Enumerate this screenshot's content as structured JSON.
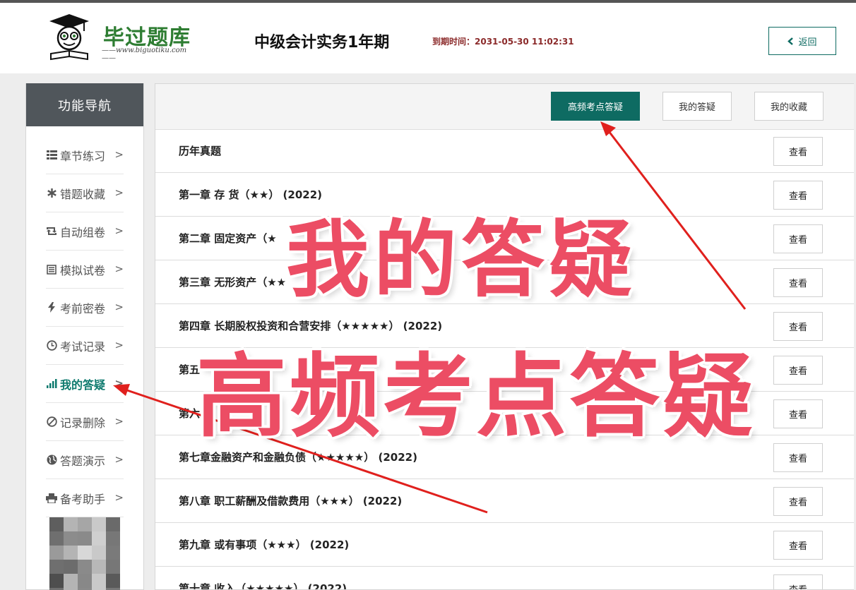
{
  "header": {
    "logo_brand": "毕过题库",
    "logo_url": "——www.biguotiku.com——",
    "course_title": "中级会计实务1年期",
    "expire_text": "到期时间：2031-05-30 11:02:31",
    "back_label": "返回",
    "back_icon": "chevron-left-icon"
  },
  "sidebar": {
    "title": "功能导航",
    "items": [
      {
        "label": "章节练习",
        "icon": "list-icon"
      },
      {
        "label": "错题收藏",
        "icon": "asterisk-icon"
      },
      {
        "label": "自动组卷",
        "icon": "retweet-icon"
      },
      {
        "label": "模拟试卷",
        "icon": "document-list-icon"
      },
      {
        "label": "考前密卷",
        "icon": "bolt-icon"
      },
      {
        "label": "考试记录",
        "icon": "clock-icon"
      },
      {
        "label": "我的答疑",
        "icon": "bar-chart-icon",
        "active": true
      },
      {
        "label": "记录删除",
        "icon": "ban-icon"
      },
      {
        "label": "答题演示",
        "icon": "globe-icon"
      },
      {
        "label": "备考助手",
        "icon": "printer-icon"
      }
    ]
  },
  "toolbar": {
    "tabs": [
      "高频考点答疑",
      "我的答疑",
      "我的收藏"
    ]
  },
  "list": {
    "view_label": "查看",
    "rows": [
      "历年真题",
      "第一章 存 货（★★） (2022)",
      "第二章 固定资产（★",
      "第三章 无形资产（★★",
      "第四章 长期股权投资和合营安排（★★★★★） (2022)",
      "第五",
      "第六",
      "第七章金融资产和金融负债（★★★★★） (2022)",
      "第八章 职工薪酬及借款费用（★★★） (2022)",
      "第九章 或有事项（★★★） (2022)",
      "第十章 收入（★★★★★） (2022)"
    ]
  },
  "overlay": {
    "caption_1": "我的答疑",
    "caption_2": "高频考点答疑",
    "color": "#ec4d64",
    "arrow_color": "#e0201d"
  },
  "colors": {
    "accent": "#0e6b62",
    "sidebar_head": "#50565b"
  }
}
